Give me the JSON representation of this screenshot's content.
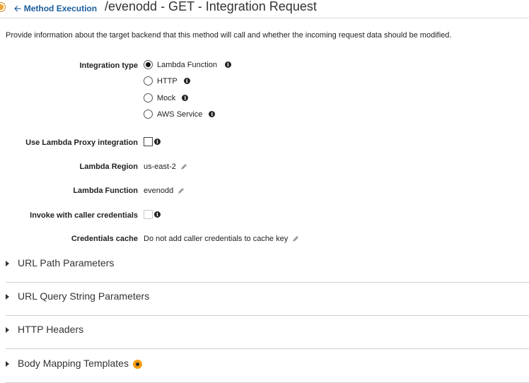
{
  "header": {
    "back_label": "Method Execution",
    "title": "/evenodd - GET - Integration Request"
  },
  "description": "Provide information about the target backend that this method will call and whether the incoming request data should be modified.",
  "integration": {
    "label": "Integration type",
    "options": [
      {
        "label": "Lambda Function",
        "selected": true
      },
      {
        "label": "HTTP",
        "selected": false
      },
      {
        "label": "Mock",
        "selected": false
      },
      {
        "label": "AWS Service",
        "selected": false
      }
    ]
  },
  "proxy": {
    "label": "Use Lambda Proxy integration",
    "checked": false
  },
  "region": {
    "label": "Lambda Region",
    "value": "us-east-2"
  },
  "function": {
    "label": "Lambda Function",
    "value": "evenodd"
  },
  "caller_credentials": {
    "label": "Invoke with caller credentials",
    "checked": false,
    "disabled": true
  },
  "credentials_cache": {
    "label": "Credentials cache",
    "value": "Do not add caller credentials to cache key"
  },
  "sections": [
    {
      "label": "URL Path Parameters"
    },
    {
      "label": "URL Query String Parameters"
    },
    {
      "label": "HTTP Headers"
    },
    {
      "label": "Body Mapping Templates"
    }
  ],
  "icons": {
    "back": "arrow-left-icon",
    "info": "info-icon",
    "edit": "pencil-icon",
    "expand": "caret-right-icon",
    "status": "orange-dot-icon"
  },
  "colors": {
    "link": "#1a5e9e",
    "accent": "#f39c12"
  }
}
